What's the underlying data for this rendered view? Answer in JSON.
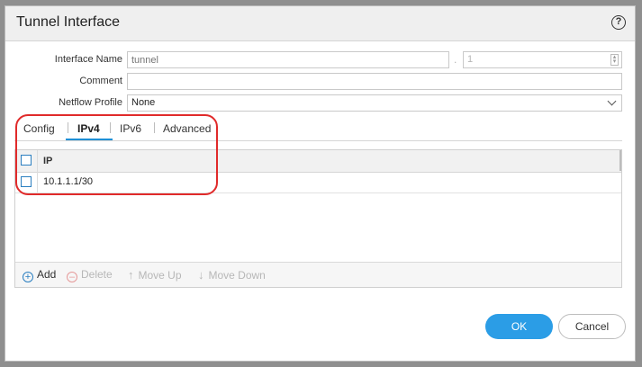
{
  "dialog": {
    "title": "Tunnel Interface",
    "help_symbol": "?"
  },
  "form": {
    "interface_name": {
      "label": "Interface Name",
      "placeholder": "tunnel",
      "separator": ".",
      "number_placeholder": "1"
    },
    "comment": {
      "label": "Comment",
      "value": ""
    },
    "netflow_profile": {
      "label": "Netflow Profile",
      "value": "None"
    }
  },
  "tabs": [
    {
      "label": "Config",
      "active": false
    },
    {
      "label": "IPv4",
      "active": true
    },
    {
      "label": "IPv6",
      "active": false
    },
    {
      "label": "Advanced",
      "active": false
    }
  ],
  "ip_table": {
    "column_header": "IP",
    "rows": [
      {
        "ip": "10.1.1.1/30",
        "checked": false
      }
    ]
  },
  "toolbar": {
    "add_label": "Add",
    "delete_label": "Delete",
    "move_up_label": "Move Up",
    "move_down_label": "Move Down"
  },
  "actions": {
    "ok_label": "OK",
    "cancel_label": "Cancel"
  },
  "colors": {
    "accent": "#2b9de6",
    "highlight": "#e02a2a",
    "tab_underline": "#1e90d6"
  }
}
